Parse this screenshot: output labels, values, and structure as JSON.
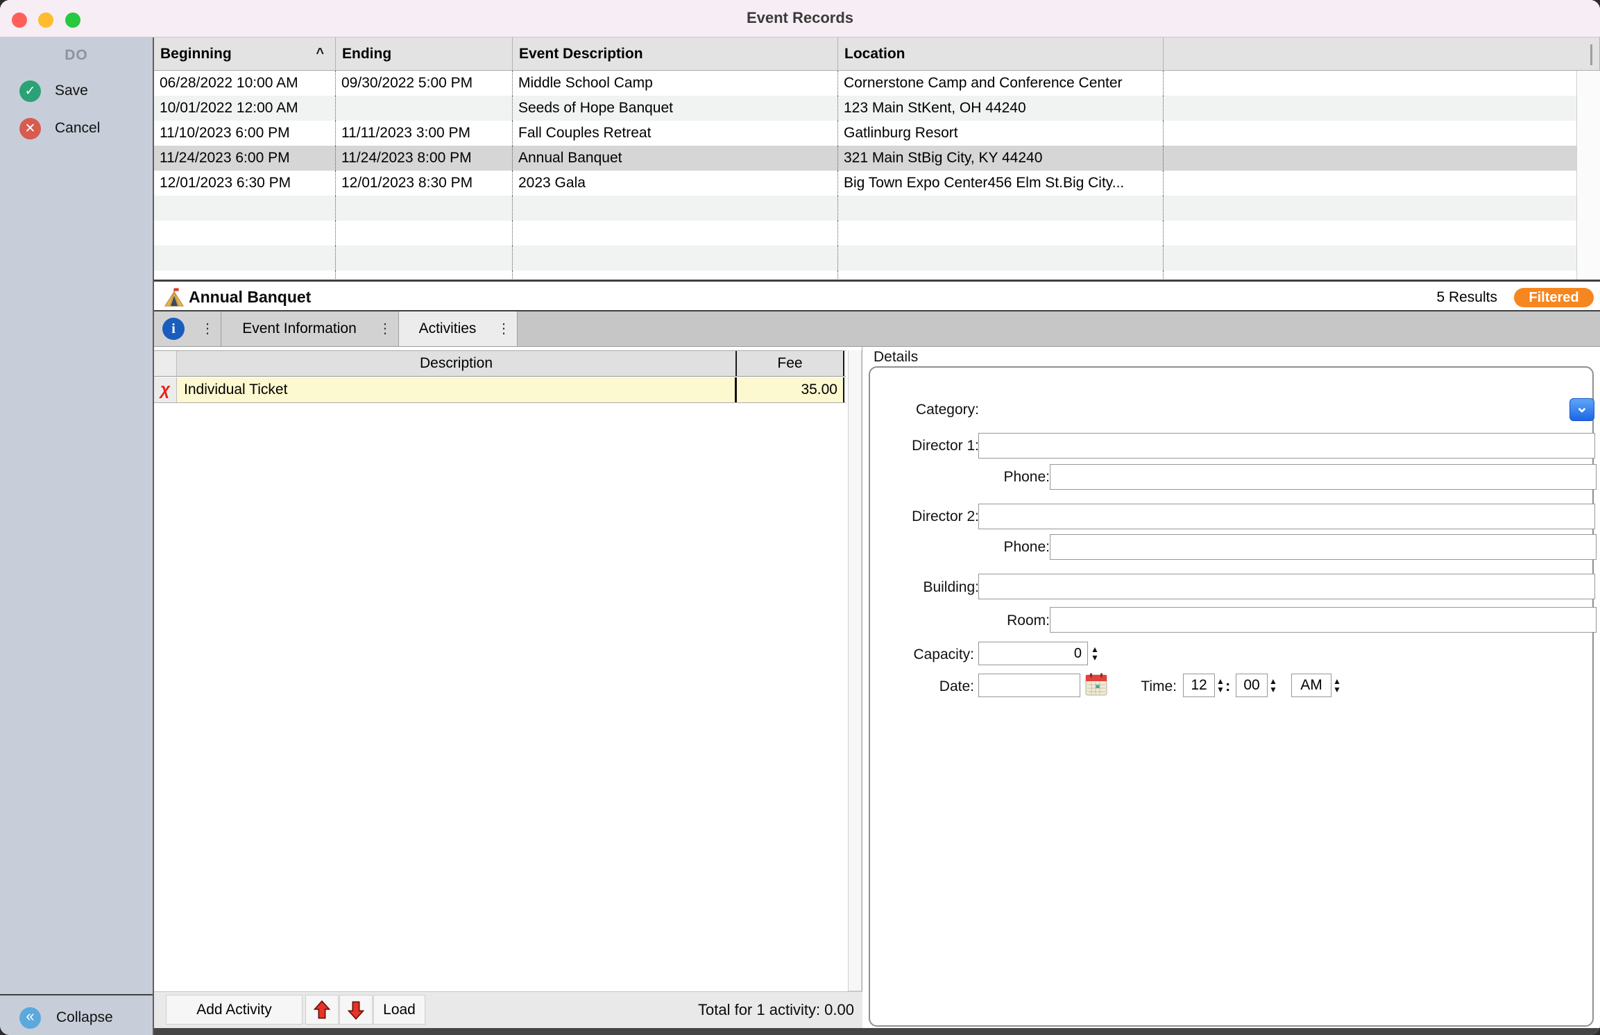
{
  "window": {
    "title": "Event Records"
  },
  "icons": {
    "sort_asc": "^",
    "check": "✓",
    "close": "✕",
    "collapse": "«",
    "info": "i",
    "overflow_dots": "⋮",
    "delete_chi": "χ",
    "chevron_down": "⌄",
    "spin_up": "▲",
    "spin_down": "▼",
    "time_separator": ":"
  },
  "colors": {
    "filtered_badge": "#f6861f",
    "save_icon": "#2ba275",
    "cancel_icon": "#d85b50",
    "collapse_icon": "#5ba8dc",
    "info_icon": "#1a5dbe",
    "dropdown_button": "#2d7bea",
    "activity_row": "#fcf8cf",
    "selected_row": "#d6d6d6",
    "sidebar": "#c7ced9",
    "titlebar": "#f6eef4"
  },
  "sidebar": {
    "header": "DO",
    "save_label": "Save",
    "cancel_label": "Cancel",
    "collapse_label": "Collapse"
  },
  "events_table": {
    "columns": {
      "beginning": "Beginning",
      "ending": "Ending",
      "description": "Event Description",
      "location": "Location"
    },
    "rows": [
      {
        "beginning": "06/28/2022 10:00 AM",
        "ending": "09/30/2022 5:00 PM",
        "description": "Middle School Camp",
        "location": "Cornerstone Camp and Conference Center",
        "selected": false
      },
      {
        "beginning": "10/01/2022 12:00 AM",
        "ending": "",
        "description": "Seeds of Hope Banquet",
        "location": "123 Main StKent, OH 44240",
        "selected": false
      },
      {
        "beginning": "11/10/2023 6:00 PM",
        "ending": "11/11/2023 3:00 PM",
        "description": "Fall Couples Retreat",
        "location": "Gatlinburg Resort",
        "selected": false
      },
      {
        "beginning": "11/24/2023 6:00 PM",
        "ending": "11/24/2023 8:00 PM",
        "description": "Annual Banquet",
        "location": "321 Main StBig City, KY 44240",
        "selected": true
      },
      {
        "beginning": "12/01/2023 6:30 PM",
        "ending": "12/01/2023 8:30 PM",
        "description": "2023 Gala",
        "location": "Big Town Expo Center456 Elm St.Big City...",
        "selected": false
      }
    ]
  },
  "record_bar": {
    "title": "Annual Banquet",
    "results_count": "5 Results",
    "filter_badge": "Filtered"
  },
  "tabs": [
    {
      "label": "Event Information",
      "selected": false
    },
    {
      "label": "Activities",
      "selected": true
    }
  ],
  "activities": {
    "columns": {
      "description": "Description",
      "fee": "Fee"
    },
    "rows": [
      {
        "description": "Individual Ticket",
        "fee": "35.00"
      }
    ],
    "add_button": "Add Activity",
    "load_button": "Load",
    "total": "Total for 1 activity: 0.00"
  },
  "details": {
    "title": "Details",
    "labels": {
      "category": "Category:",
      "director1": "Director 1:",
      "phone": "Phone:",
      "director2": "Director 2:",
      "building": "Building:",
      "room": "Room:",
      "capacity": "Capacity:",
      "date": "Date:",
      "time": "Time:"
    },
    "values": {
      "capacity": "0",
      "hour": "12",
      "minute": "00",
      "ampm": "AM"
    }
  }
}
